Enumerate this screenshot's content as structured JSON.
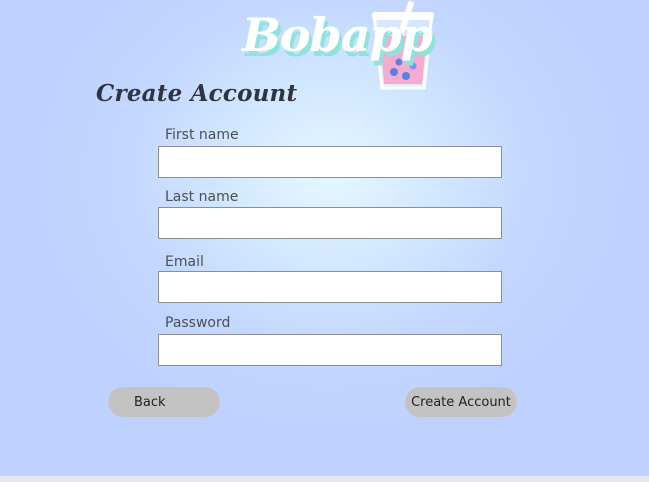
{
  "brand": {
    "name": "Bobapp"
  },
  "page": {
    "title": "Create Account"
  },
  "form": {
    "fields": [
      {
        "label": "First name",
        "value": "",
        "placeholder": ""
      },
      {
        "label": "Last name",
        "value": "",
        "placeholder": ""
      },
      {
        "label": "Email",
        "value": "",
        "placeholder": ""
      },
      {
        "label": "Password",
        "value": "",
        "placeholder": ""
      }
    ]
  },
  "buttons": {
    "back": "Back",
    "create_account": "Create Account"
  },
  "colors": {
    "background": "#c2d6ff",
    "logo_text": "#ffffff",
    "logo_shadow": "#8ee3dc",
    "cup_drink": "#f4a6cf",
    "button": "#c3c3c3"
  },
  "icons": {
    "logo_cup": "boba-cup-icon"
  }
}
